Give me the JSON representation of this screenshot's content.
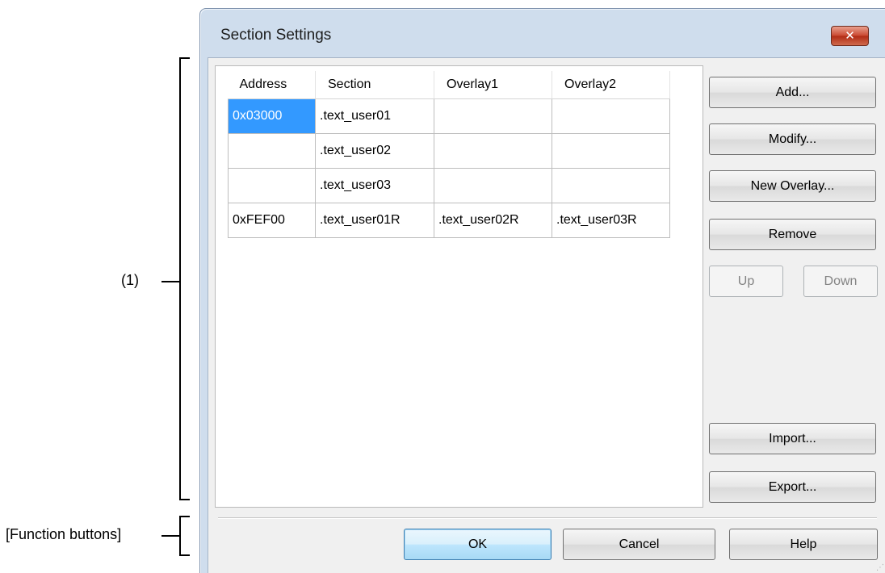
{
  "annotations": {
    "region1": "(1)",
    "function_buttons": "[Function buttons]"
  },
  "dialog": {
    "title": "Section Settings",
    "close_glyph": "✕"
  },
  "table": {
    "columns": [
      "Address",
      "Section",
      "Overlay1",
      "Overlay2"
    ],
    "rows": [
      [
        "0x03000",
        ".text_user01",
        "",
        ""
      ],
      [
        "",
        ".text_user02",
        "",
        ""
      ],
      [
        "",
        ".text_user03",
        "",
        ""
      ],
      [
        "0xFEF00",
        ".text_user01R",
        ".text_user02R",
        ".text_user03R"
      ]
    ],
    "selected_cell": "0x03000"
  },
  "side_buttons": {
    "add": "Add...",
    "modify": "Modify...",
    "new_overlay": "New Overlay...",
    "remove": "Remove",
    "up": "Up",
    "down": "Down",
    "import": "Import...",
    "export": "Export..."
  },
  "function_buttons": {
    "ok": "OK",
    "cancel": "Cancel",
    "help": "Help"
  },
  "colors": {
    "selection": "#3399ff",
    "title_bar": "#cfdded",
    "close_button": "#c9472f"
  }
}
